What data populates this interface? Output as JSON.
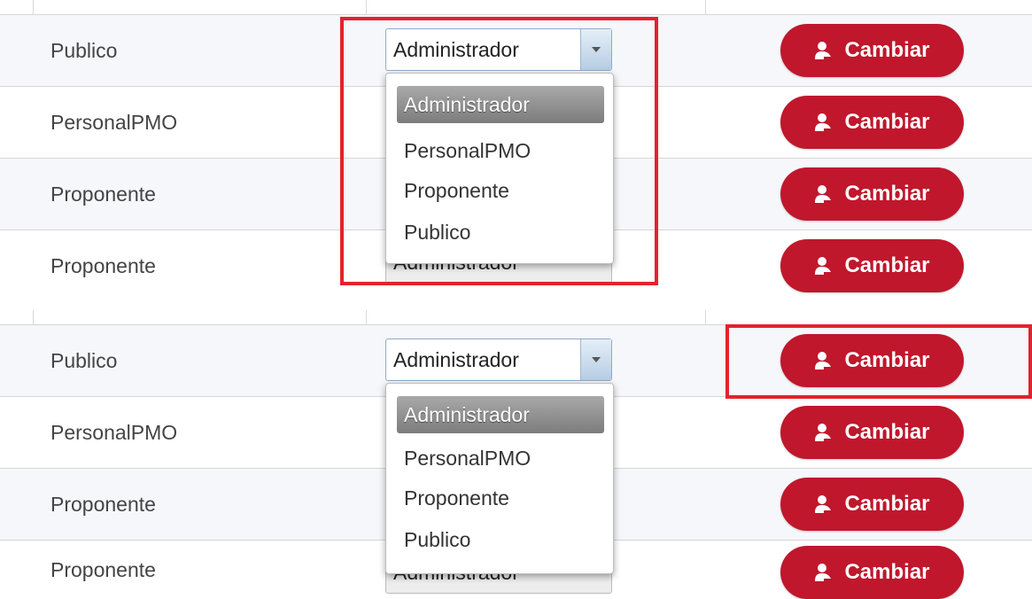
{
  "panels": [
    {
      "rows": [
        {
          "role": "Publico",
          "button_label": "Cambiar"
        },
        {
          "role": "PersonalPMO",
          "button_label": "Cambiar"
        },
        {
          "role": "Proponente",
          "button_label": "Cambiar"
        },
        {
          "role": "Proponente",
          "button_label": "Cambiar"
        }
      ],
      "select": {
        "value": "Administrador",
        "hidden_value": "Administrador"
      },
      "dropdown": {
        "options": [
          "Administrador",
          "PersonalPMO",
          "Proponente",
          "Publico"
        ],
        "selected": "Administrador"
      },
      "highlight": "role-dropdown"
    },
    {
      "rows": [
        {
          "role": "Publico",
          "button_label": "Cambiar"
        },
        {
          "role": "PersonalPMO",
          "button_label": "Cambiar"
        },
        {
          "role": "Proponente",
          "button_label": "Cambiar"
        },
        {
          "role": "Proponente",
          "button_label": "Cambiar"
        }
      ],
      "select": {
        "value": "Administrador",
        "hidden_value": "Administrador"
      },
      "dropdown": {
        "options": [
          "Administrador",
          "PersonalPMO",
          "Proponente",
          "Publico"
        ],
        "selected": "Administrador"
      },
      "highlight": "cambiar-button"
    }
  ],
  "colors": {
    "button": "#c0172c",
    "highlight": "#e3222d",
    "row_alt": "#f5f7fb",
    "selected_option": "#8f8f8f"
  },
  "icons": {
    "button_icon": "user-icon",
    "select_arrow": "caret-down-icon"
  }
}
